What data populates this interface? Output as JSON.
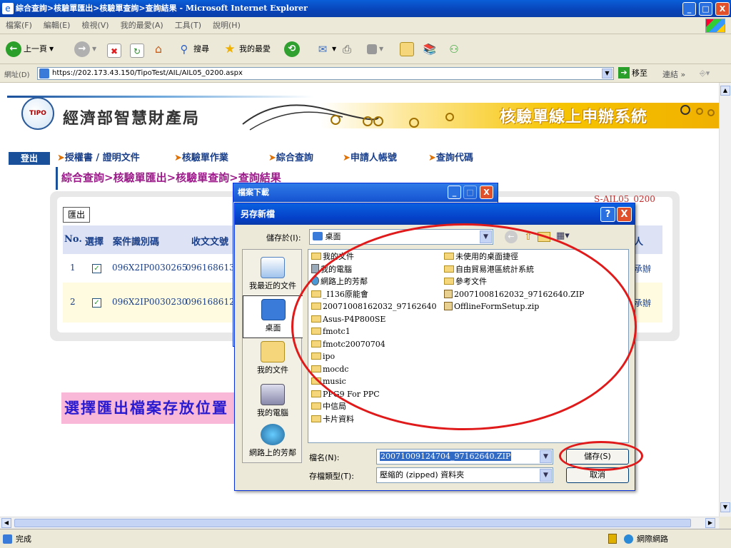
{
  "window": {
    "title": "綜合查詢>核驗單匯出>核驗單查詢>查詢結果 - Microsoft Internet Explorer",
    "min": "_",
    "max": "□",
    "close": "X"
  },
  "menu": [
    "檔案(F)",
    "編輯(E)",
    "檢視(V)",
    "我的最愛(A)",
    "工具(T)",
    "說明(H)"
  ],
  "toolbar": {
    "back": "上一頁",
    "search": "搜尋",
    "favorites": "我的最愛"
  },
  "address": {
    "label": "網址(D)",
    "url": "https://202.173.43.150/TipoTest/AIL/AIL05_0200.aspx",
    "go": "移至",
    "links": "連結"
  },
  "site": {
    "logo_text": "TIPO",
    "org_name": "經濟部智慧財產局",
    "system_title": "核驗單線上申辦系統",
    "logout": "登出",
    "nav": [
      "授權書 / 證明文件",
      "核驗單作業",
      "綜合查詢",
      "申請人帳號",
      "查詢代碼"
    ],
    "breadcrumb": "綜合查詢>核驗單匯出>核驗單查詢>查詢結果",
    "page_code": "S-AIL05_0200",
    "export_button": "匯出",
    "table": {
      "headers": [
        "No.",
        "選擇",
        "案件識別碼",
        "收文文號",
        "人"
      ],
      "rows": [
        {
          "no": "1",
          "checked": "✓",
          "case_id": "096X2IP0030265",
          "doc_no": "0961686130",
          "applicant": "李承辦"
        },
        {
          "no": "2",
          "checked": "✓",
          "case_id": "096X2IP0030230",
          "doc_no": "0961686120",
          "applicant": "李承辦"
        }
      ]
    },
    "annotation": "選擇匯出檔案存放位置"
  },
  "download_dialog": {
    "title": "檔案下載"
  },
  "save_dialog": {
    "title": "另存新檔",
    "help": "?",
    "close": "X",
    "save_in_label": "儲存於(I):",
    "save_in_value": "桌面",
    "places": [
      "我最近的文件",
      "桌面",
      "我的文件",
      "我的電腦",
      "網路上的芳鄰"
    ],
    "files_left": [
      "我的文件",
      "我的電腦",
      "網路上的芳鄰",
      "_I136原能會",
      "20071008162032_97162640",
      "Asus-P4P800SE",
      "fmotc1",
      "fmotc20070704",
      "ipo",
      "mocdc",
      "music",
      "PPG9 For PPC",
      "中信局",
      "卡片資料"
    ],
    "files_right": [
      "未使用的桌面捷徑",
      "自由貿易港區統計系統",
      "參考文件",
      "20071008162032_97162640.ZIP",
      "OfflineFormSetup.zip"
    ],
    "filename_label": "檔名(N):",
    "filename_value": "20071009124704_97162640.ZIP",
    "filetype_label": "存檔類型(T):",
    "filetype_value": "壓縮的 (zipped) 資料夾",
    "save_button": "儲存(S)",
    "cancel_button": "取消"
  },
  "status": {
    "text": "完成",
    "zone": "網際網路"
  }
}
